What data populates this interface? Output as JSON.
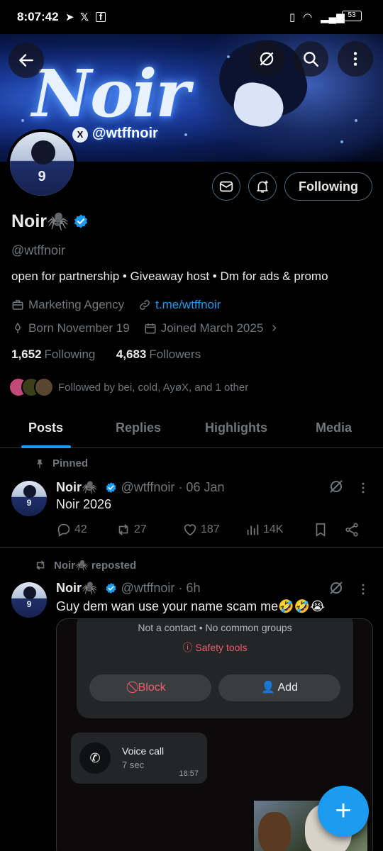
{
  "status_bar": {
    "time": "8:07:42",
    "battery": "53"
  },
  "banner": {
    "title": "Noir",
    "handle": "@wtffnoir",
    "x_badge": "X"
  },
  "profile": {
    "display_name": "Noir🕷️",
    "handle": "@wtffnoir",
    "avatar_number": "9",
    "bio": "open for partnership • Giveaway host • Dm for ads & promo",
    "category": "Marketing Agency",
    "link": "t.me/wtffnoir",
    "born": "Born November 19",
    "joined": "Joined March 2025",
    "following_count": "1,652",
    "following_label": "Following",
    "followers_count": "4,683",
    "followers_label": "Followers",
    "followed_by": "Followed by bei, cold, AyøX, and 1 other",
    "follow_button": "Following"
  },
  "tabs": [
    "Posts",
    "Replies",
    "Highlights",
    "Media"
  ],
  "posts": [
    {
      "context": "Pinned",
      "name": "Noir🕷️",
      "handle": "@wtffnoir",
      "time": "· 06 Jan",
      "text": "Noir 2026",
      "replies": "42",
      "reposts": "27",
      "likes": "187",
      "views": "14K"
    },
    {
      "context": "Noir🕷️ reposted",
      "name": "Noir🕷️",
      "handle": "@wtffnoir",
      "time": "· 6h",
      "text": "Guy dem wan use your name scam me🤣🤣😭",
      "media": {
        "not_contact": "Not a contact • No common groups",
        "safety": "Safety tools",
        "block": "Block",
        "add": "Add",
        "call_title": "Voice call",
        "call_duration": "7 sec",
        "call_time": "18:57"
      }
    }
  ],
  "colors": {
    "accent": "#1d9bf0",
    "muted": "#71767b",
    "text": "#e7e9ea",
    "danger": "#f15c6d"
  }
}
